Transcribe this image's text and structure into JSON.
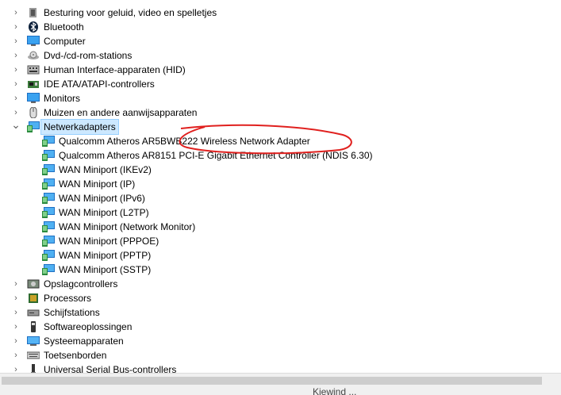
{
  "tree": {
    "items": [
      {
        "label": "Besturing voor geluid, video en spelletjes",
        "icon": "speaker-icon",
        "level": 0,
        "expanded": false
      },
      {
        "label": "Bluetooth",
        "icon": "bluetooth-icon",
        "level": 0,
        "expanded": false
      },
      {
        "label": "Computer",
        "icon": "computer-icon",
        "level": 0,
        "expanded": false
      },
      {
        "label": "Dvd-/cd-rom-stations",
        "icon": "disc-drive-icon",
        "level": 0,
        "expanded": false
      },
      {
        "label": "Human Interface-apparaten (HID)",
        "icon": "hid-icon",
        "level": 0,
        "expanded": false
      },
      {
        "label": "IDE ATA/ATAPI-controllers",
        "icon": "ide-controller-icon",
        "level": 0,
        "expanded": false
      },
      {
        "label": "Monitors",
        "icon": "monitor-icon",
        "level": 0,
        "expanded": false
      },
      {
        "label": "Muizen en andere aanwijsapparaten",
        "icon": "mouse-icon",
        "level": 0,
        "expanded": false
      },
      {
        "label": "Netwerkadapters",
        "icon": "network-adapter-icon",
        "level": 0,
        "expanded": true,
        "selected": true
      },
      {
        "label": "Qualcomm Atheros AR5BWB222 Wireless Network Adapter",
        "icon": "network-adapter-icon",
        "level": 1
      },
      {
        "label": "Qualcomm Atheros AR8151 PCI-E Gigabit Ethernet Controller (NDIS 6.30)",
        "icon": "network-adapter-icon",
        "level": 1
      },
      {
        "label": "WAN Miniport (IKEv2)",
        "icon": "network-adapter-icon",
        "level": 1
      },
      {
        "label": "WAN Miniport (IP)",
        "icon": "network-adapter-icon",
        "level": 1
      },
      {
        "label": "WAN Miniport (IPv6)",
        "icon": "network-adapter-icon",
        "level": 1
      },
      {
        "label": "WAN Miniport (L2TP)",
        "icon": "network-adapter-icon",
        "level": 1
      },
      {
        "label": "WAN Miniport (Network Monitor)",
        "icon": "network-adapter-icon",
        "level": 1
      },
      {
        "label": "WAN Miniport (PPPOE)",
        "icon": "network-adapter-icon",
        "level": 1
      },
      {
        "label": "WAN Miniport (PPTP)",
        "icon": "network-adapter-icon",
        "level": 1
      },
      {
        "label": "WAN Miniport (SSTP)",
        "icon": "network-adapter-icon",
        "level": 1
      },
      {
        "label": "Opslagcontrollers",
        "icon": "storage-controller-icon",
        "level": 0,
        "expanded": false
      },
      {
        "label": "Processors",
        "icon": "processor-icon",
        "level": 0,
        "expanded": false
      },
      {
        "label": "Schijfstations",
        "icon": "disk-drive-icon",
        "level": 0,
        "expanded": false
      },
      {
        "label": "Softwareoplossingen",
        "icon": "software-icon",
        "level": 0,
        "expanded": false
      },
      {
        "label": "Systeemapparaten",
        "icon": "system-device-icon",
        "level": 0,
        "expanded": false
      },
      {
        "label": "Toetsenborden",
        "icon": "keyboard-icon",
        "level": 0,
        "expanded": false
      },
      {
        "label": "Universal Serial Bus-controllers",
        "icon": "usb-icon",
        "level": 0,
        "expanded": false
      }
    ]
  },
  "annotation": {
    "color": "#e0201e"
  },
  "status": {
    "partial_text": "Kiewind ..."
  }
}
